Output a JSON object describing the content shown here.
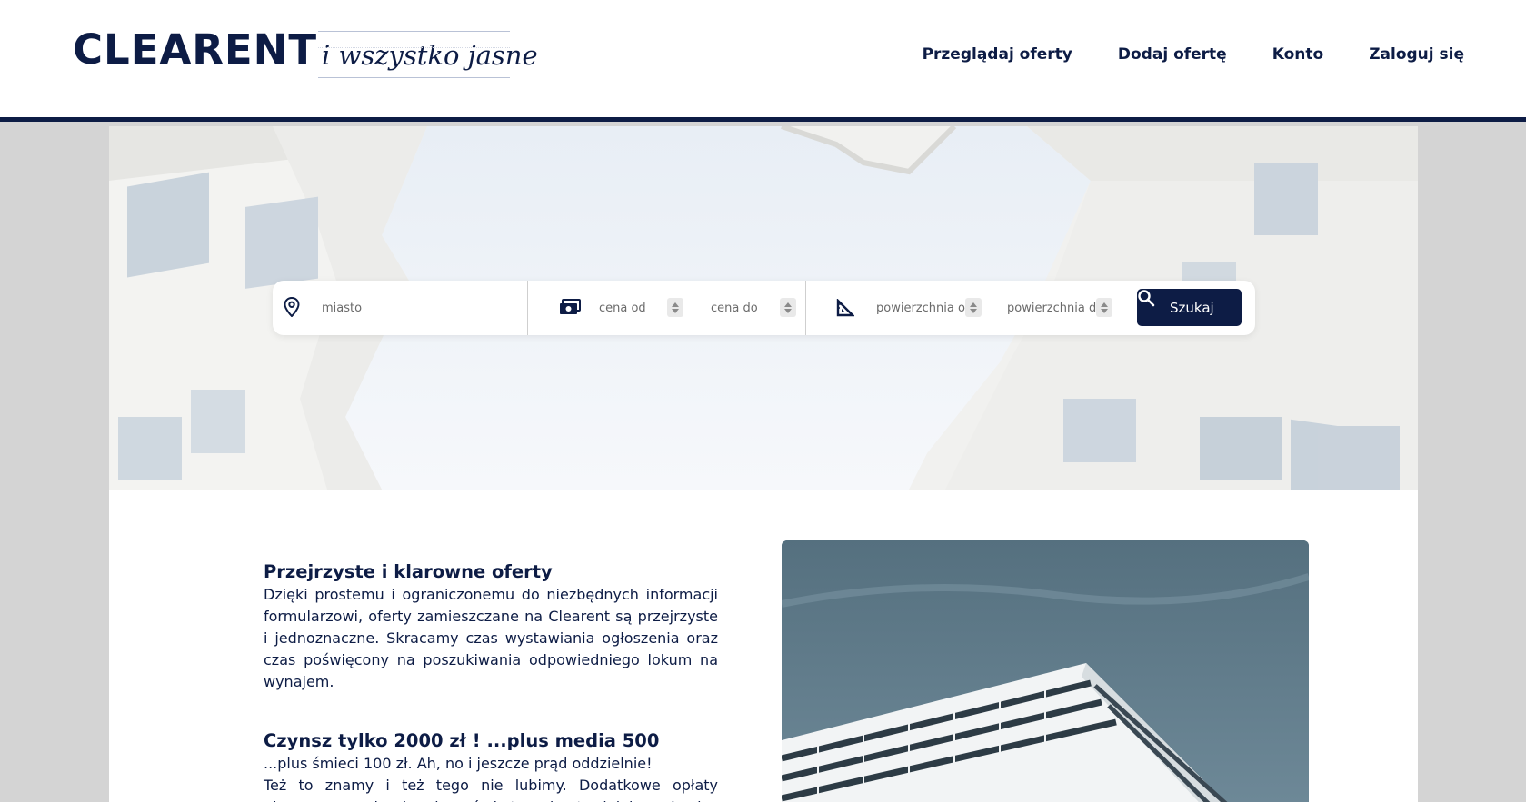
{
  "header": {
    "logo": "CLEARENT",
    "tagline": "i wszystko jasne",
    "nav": [
      {
        "label": "Przeglądaj oferty"
      },
      {
        "label": "Dodaj ofertę"
      },
      {
        "label": "Konto"
      },
      {
        "label": "Zaloguj się"
      }
    ]
  },
  "search": {
    "city_placeholder": "miasto",
    "price_from_placeholder": "cena od",
    "price_to_placeholder": "cena do",
    "area_from_placeholder": "powierzchnia od",
    "area_to_placeholder": "powierzchnia do",
    "submit_label": "Szukaj"
  },
  "icons": {
    "location": "location-pin-icon",
    "money": "money-icon",
    "area": "set-square-icon",
    "search": "search-icon"
  },
  "content": {
    "sections": [
      {
        "title": "Przejrzyste i klarowne oferty",
        "body": "Dzięki prostemu i ograniczonemu do niezbędnych informacji formularzowi, oferty zamieszczane na Clearent są przejrzyste i jednoznaczne. Skracamy czas wystawiania ogłoszenia oraz czas poświęcony na poszukiwania odpowiedniego lokum na wynajem."
      },
      {
        "title": "Czynsz tylko 2000 zł ! ...plus media 500",
        "line1": "...plus śmieci 100 zł. Ah, no i jeszcze prąd oddzielnie!",
        "body": "Też to znamy i też tego nie lubimy. Dodatkowe opłaty ukrywane w opisach ogłoszeń skutecznie utrudniają szukanie"
      }
    ]
  },
  "colors": {
    "brand": "#0d1c45",
    "page_background": "#d4d4d4",
    "card_background": "#ffffff"
  }
}
